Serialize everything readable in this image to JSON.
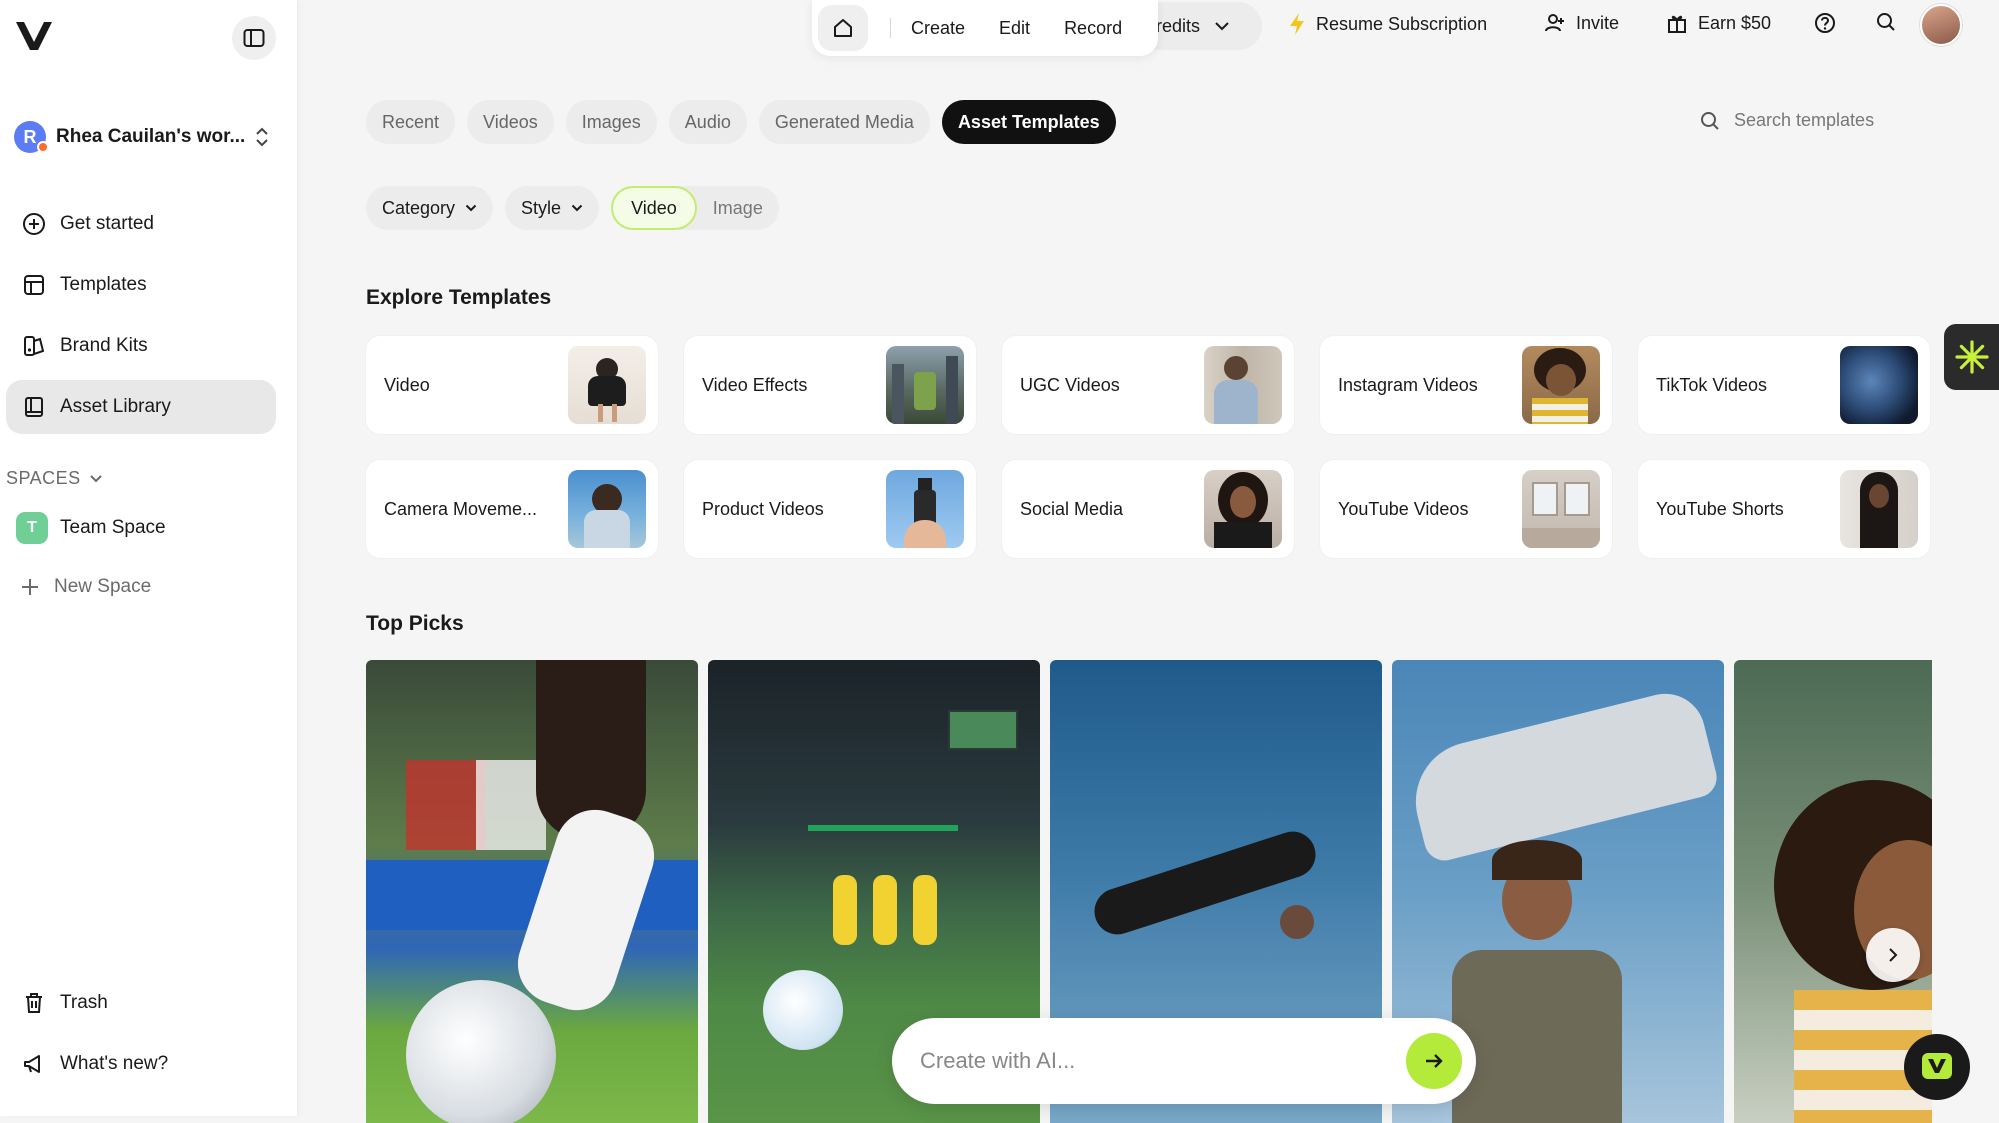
{
  "sidebar": {
    "workspace_initial": "R",
    "workspace_name": "Rhea Cauilan's wor...",
    "nav": [
      {
        "label": "Get started",
        "icon": "plus-circle-icon"
      },
      {
        "label": "Templates",
        "icon": "templates-icon"
      },
      {
        "label": "Brand Kits",
        "icon": "brand-kit-icon"
      },
      {
        "label": "Asset Library",
        "icon": "library-icon",
        "active": true
      }
    ],
    "spaces_header": "SPACES",
    "team_space_initial": "T",
    "team_space_label": "Team Space",
    "new_space_label": "New Space",
    "trash_label": "Trash",
    "whats_new_label": "What's new?"
  },
  "topbar": {
    "menu": [
      "Create",
      "Edit",
      "Record"
    ],
    "credits_label": "redits",
    "resume_label": "Resume Subscription",
    "invite_label": "Invite",
    "earn_label": "Earn $50"
  },
  "tabs": [
    {
      "label": "Recent"
    },
    {
      "label": "Videos"
    },
    {
      "label": "Images"
    },
    {
      "label": "Audio"
    },
    {
      "label": "Generated Media"
    },
    {
      "label": "Asset Templates",
      "active": true
    }
  ],
  "search": {
    "placeholder": "Search templates"
  },
  "filters": {
    "category_label": "Category",
    "style_label": "Style",
    "video_label": "Video",
    "image_label": "Image",
    "selected": "Video"
  },
  "explore": {
    "title": "Explore Templates",
    "cards": [
      {
        "label": "Video"
      },
      {
        "label": "Video Effects"
      },
      {
        "label": "UGC Videos"
      },
      {
        "label": "Instagram Videos"
      },
      {
        "label": "TikTok Videos"
      },
      {
        "label": "Camera Moveme..."
      },
      {
        "label": "Product Videos"
      },
      {
        "label": "Social Media"
      },
      {
        "label": "YouTube Videos"
      },
      {
        "label": "YouTube Shorts"
      }
    ]
  },
  "top_picks": {
    "title": "Top Picks"
  },
  "ai_bar": {
    "placeholder": "Create with AI..."
  },
  "colors": {
    "accent_green": "#b4ea3a",
    "active_tab": "#111111",
    "selected_outline": "#c4ec6c"
  }
}
